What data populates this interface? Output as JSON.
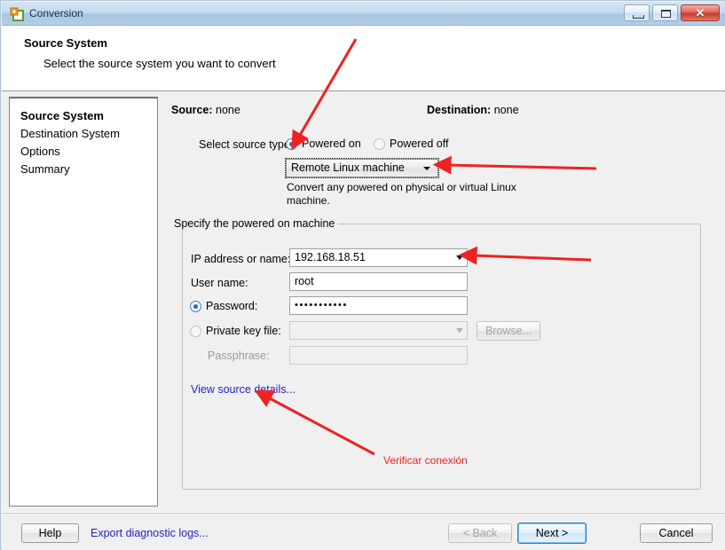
{
  "window": {
    "title": "Conversion",
    "icon": "converter-app-icon",
    "controls": {
      "minimize": "minimize-button",
      "maximize": "maximize-button",
      "close_glyph": "✕"
    }
  },
  "header": {
    "title": "Source System",
    "subtitle": "Select the source system you want to convert"
  },
  "sidebar": {
    "items": [
      {
        "label": "Source System",
        "current": true
      },
      {
        "label": "Destination System",
        "current": false
      },
      {
        "label": "Options",
        "current": false
      },
      {
        "label": "Summary",
        "current": false
      }
    ]
  },
  "main": {
    "source_label": "Source:",
    "source_value": "none",
    "destination_label": "Destination:",
    "destination_value": "none",
    "select_source_type_label": "Select source type:",
    "radios": [
      {
        "label": "Powered on",
        "checked": true
      },
      {
        "label": "Powered off",
        "checked": false
      }
    ],
    "source_type_combo": {
      "value": "Remote Linux machine",
      "focused": true
    },
    "source_type_description": "Convert any powered on physical or virtual Linux machine.",
    "group": {
      "legend": "Specify the powered on machine",
      "fields": {
        "ip_label": "IP address or name:",
        "ip_value": "192.168.18.51",
        "user_label": "User name:",
        "user_value": "root",
        "password_label": "Password:",
        "password_value": "•••••••••••",
        "password_selected": true,
        "private_key_label": "Private key file:",
        "private_key_value": "",
        "private_key_selected": false,
        "browse_label": "Browse...",
        "passphrase_label": "Passphrase:",
        "passphrase_value": ""
      },
      "view_details_link": "View source details..."
    }
  },
  "footer": {
    "help_label": "Help",
    "export_logs_label": "Export diagnostic logs...",
    "back_label": "< Back",
    "next_label": "Next >",
    "cancel_label": "Cancel"
  },
  "annotations": {
    "color": "#ee2222",
    "note_1": "Verificar conexión"
  }
}
